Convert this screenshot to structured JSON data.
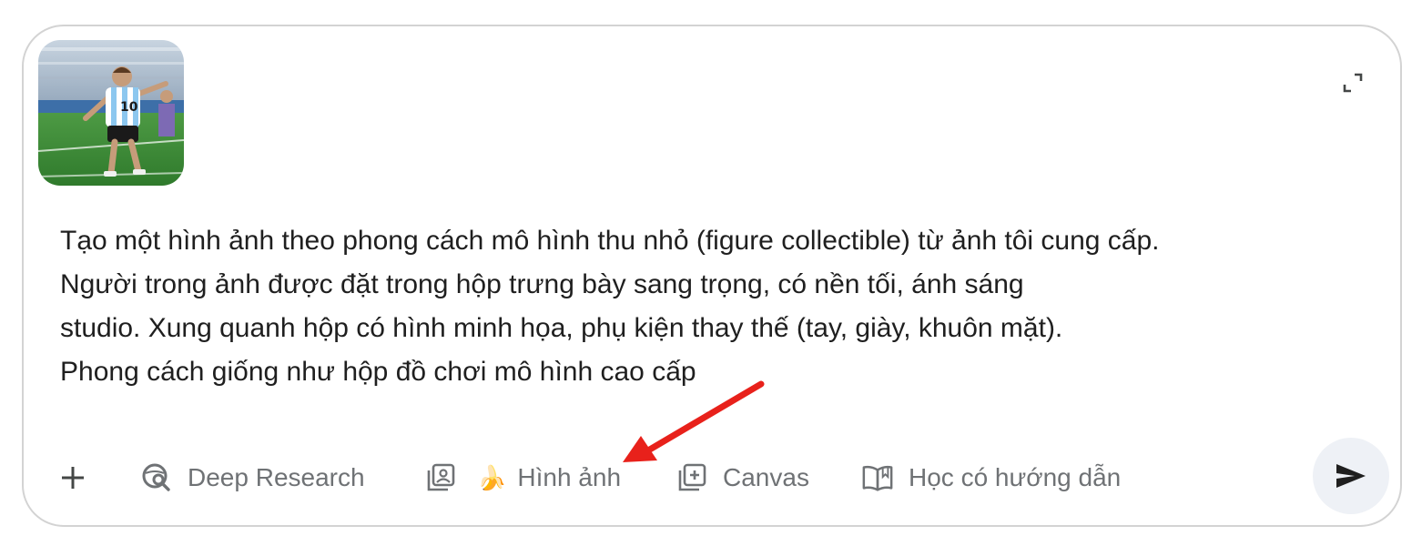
{
  "attachment": {
    "icon": "photo-thumbnail",
    "subject_colors": {
      "pitch": "#3f8f3a",
      "shirt_stripe": "#8cc7ef",
      "shorts": "#1a1a1a"
    }
  },
  "prompt": {
    "lines": [
      "Tạo một hình ảnh theo phong cách mô hình thu nhỏ (figure collectible) từ ảnh tôi cung cấp.",
      "Người trong ảnh được đặt trong hộp trưng bày sang trọng, có nền tối, ánh sáng",
      "studio. Xung quanh hộp có hình minh họa, phụ kiện thay thế (tay, giày, khuôn mặt).",
      "Phong cách giống như hộp đồ chơi mô hình cao cấp"
    ]
  },
  "toolbar": {
    "plus_icon": "plus-icon",
    "deep_research": {
      "label": "Deep Research",
      "icon": "globe-search-icon"
    },
    "image": {
      "label": "Hình ảnh",
      "emoji": "🍌",
      "icon": "image-stack-icon"
    },
    "canvas": {
      "label": "Canvas",
      "icon": "canvas-add-icon"
    },
    "guided_learning": {
      "label": "Học có hướng dẫn",
      "icon": "open-book-icon"
    },
    "send_icon": "send-icon",
    "expand_icon": "expand-icon"
  },
  "colors": {
    "border": "#d3d3d3",
    "text": "#1f1f1f",
    "tool_text": "#6f7275",
    "send_bg": "#eef1f6",
    "annotation_arrow": "#e8211b"
  }
}
